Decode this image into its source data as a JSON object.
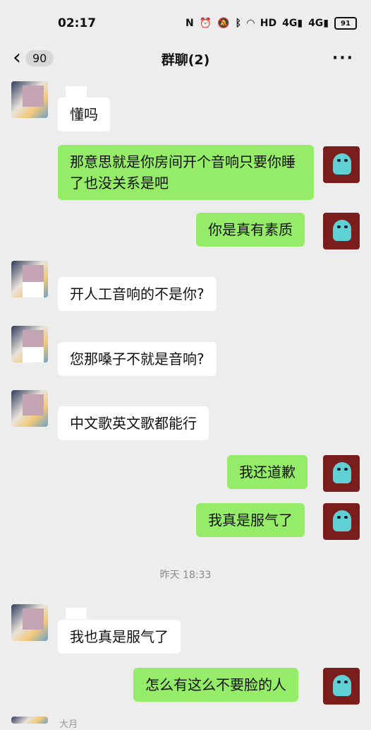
{
  "status_bar": {
    "time": "02:17",
    "icons": [
      "nfc-icon",
      "alarm-icon",
      "mute-icon",
      "bluetooth-icon",
      "wifi-icon",
      "hd-icon",
      "signal-4g-icon",
      "signal-4g-icon"
    ],
    "battery": "91"
  },
  "header": {
    "back_count": "90",
    "title": "群聊(2)"
  },
  "messages": [
    {
      "side": "left",
      "text": "懂吗"
    },
    {
      "side": "right",
      "text": "那意思就是你房间开个音响只要你睡了也没关系是吧"
    },
    {
      "side": "right",
      "text": "你是真有素质"
    },
    {
      "side": "left",
      "text": "开人工音响的不是你?"
    },
    {
      "side": "left",
      "text": "您那嗓子不就是音响?"
    },
    {
      "side": "left",
      "text": "中文歌英文歌都能行"
    },
    {
      "side": "right",
      "text": "我还道歉"
    },
    {
      "side": "right",
      "text": "我真是服气了"
    },
    {
      "side": "left",
      "text": "我也真是服气了"
    },
    {
      "side": "right",
      "text": "怎么有这么不要脸的人"
    }
  ],
  "timestamp": "昨天 18:33",
  "partial_label": "大月",
  "colors": {
    "background": "#ededed",
    "bubble_right": "#95ec69",
    "bubble_left": "#ffffff"
  }
}
